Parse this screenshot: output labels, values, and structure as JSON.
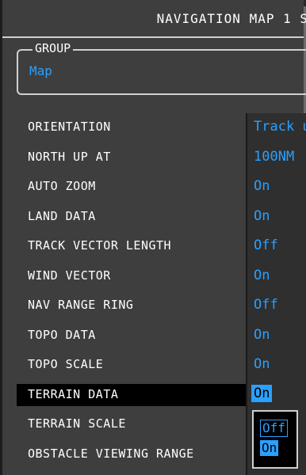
{
  "window": {
    "title": "NAVIGATION MAP 1 S"
  },
  "group": {
    "legend": "GROUP",
    "value": "Map"
  },
  "settings": [
    {
      "label": "ORIENTATION",
      "value": "Track u"
    },
    {
      "label": "NORTH UP AT",
      "value": "100NM"
    },
    {
      "label": "AUTO ZOOM",
      "value": "On"
    },
    {
      "label": "LAND DATA",
      "value": "On"
    },
    {
      "label": "TRACK VECTOR LENGTH",
      "value": "Off"
    },
    {
      "label": "WIND VECTOR",
      "value": "On"
    },
    {
      "label": "NAV RANGE RING",
      "value": "Off"
    },
    {
      "label": "TOPO DATA",
      "value": "On"
    },
    {
      "label": "TOPO SCALE",
      "value": "On"
    },
    {
      "label": "TERRAIN DATA",
      "value": "On"
    },
    {
      "label": "TERRAIN SCALE",
      "value": ""
    },
    {
      "label": "OBSTACLE VIEWING RANGE",
      "value": ""
    }
  ],
  "dropdown": {
    "options": [
      "Off",
      "On"
    ],
    "selected": "On"
  },
  "colors": {
    "value_cyan": "#2aa0ff",
    "background": "#3e3e3e",
    "text": "#ffffff"
  }
}
